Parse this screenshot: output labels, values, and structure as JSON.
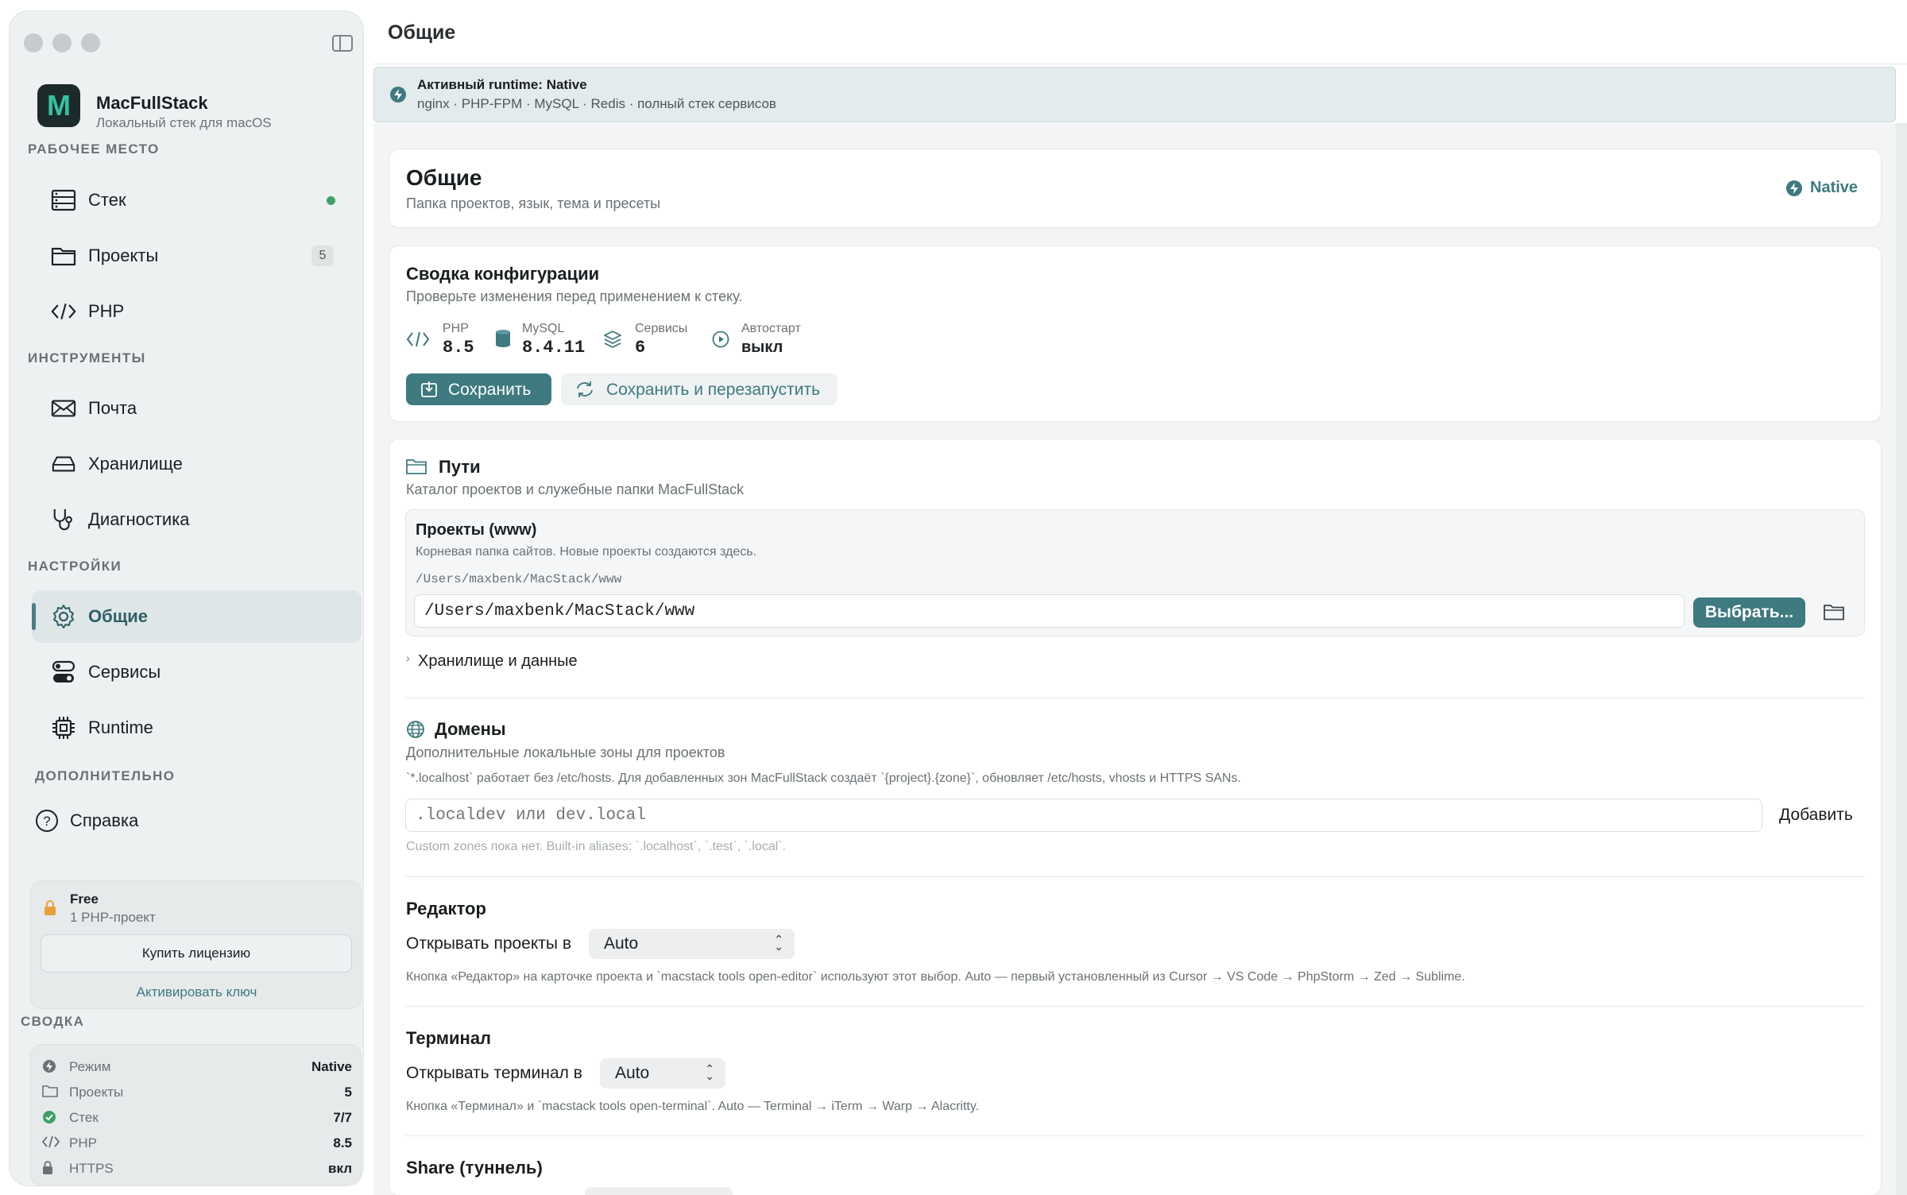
{
  "window": {
    "title": "Общие"
  },
  "brand": {
    "name": "MacFullStack",
    "subtitle": "Локальный стек для macOS",
    "logo_letter": "M"
  },
  "sidebar": {
    "sections": {
      "workspace": "РАБОЧЕЕ МЕСТО",
      "tools": "ИНСТРУМЕНТЫ",
      "settings": "НАСТРОЙКИ",
      "extra": "ДОПОЛНИТЕЛЬНО"
    },
    "items": [
      {
        "label": "Стек",
        "icon": "server-icon",
        "status": "running"
      },
      {
        "label": "Проекты",
        "icon": "folder-icon",
        "count": "5"
      },
      {
        "label": "PHP",
        "icon": "code-icon"
      },
      {
        "label": "Почта",
        "icon": "mail-icon"
      },
      {
        "label": "Хранилище",
        "icon": "drive-icon"
      },
      {
        "label": "Диагностика",
        "icon": "stethoscope-icon"
      },
      {
        "label": "Общие",
        "icon": "gear-icon",
        "active": true
      },
      {
        "label": "Сервисы",
        "icon": "toggles-icon"
      },
      {
        "label": "Runtime",
        "icon": "chip-icon"
      },
      {
        "label": "Справка",
        "icon": "help-icon"
      }
    ]
  },
  "license": {
    "plan": "Free",
    "limit": "1 PHP-проект",
    "buy_label": "Купить лицензию",
    "activate_label": "Активировать ключ"
  },
  "summary": {
    "title": "СВОДКА",
    "rows": [
      {
        "label": "Режим",
        "value": "Native",
        "icon": "bolt-icon"
      },
      {
        "label": "Проекты",
        "value": "5",
        "icon": "folder-icon"
      },
      {
        "label": "Стек",
        "value": "7/7",
        "icon": "check-circle-icon"
      },
      {
        "label": "PHP",
        "value": "8.5",
        "icon": "code-icon"
      },
      {
        "label": "HTTPS",
        "value": "вкл",
        "icon": "lock-icon"
      }
    ]
  },
  "banner": {
    "title": "Активный runtime: Native",
    "subtitle": "nginx · PHP-FPM · MySQL · Redis · полный стек сервисов"
  },
  "header_card": {
    "title": "Общие",
    "subtitle": "Папка проектов, язык, тема и пресеты",
    "badge": "Native"
  },
  "config": {
    "title": "Сводка конфигурации",
    "subtitle": "Проверьте изменения перед применением к стеку.",
    "stats": [
      {
        "label": "PHP",
        "value": "8.5"
      },
      {
        "label": "MySQL",
        "value": "8.4.11"
      },
      {
        "label": "Сервисы",
        "value": "6"
      },
      {
        "label": "Автостарт",
        "value": "выкл"
      }
    ],
    "save_label": "Сохранить",
    "save_restart_label": "Сохранить и перезапустить"
  },
  "paths": {
    "title": "Пути",
    "subtitle": "Каталог проектов и служебные папки MacFullStack",
    "projects_title": "Проекты (www)",
    "projects_desc": "Корневая папка сайтов. Новые проекты создаются здесь.",
    "current_path": "/Users/maxbenk/MacStack/www",
    "path_value": "/Users/maxbenk/MacStack/www",
    "choose_label": "Выбрать...",
    "storage_label": "Хранилище и данные"
  },
  "domains": {
    "title": "Домены",
    "subtitle": "Дополнительные локальные зоны для проектов",
    "note": "`*.localhost` работает без /etc/hosts. Для добавленных зон MacFullStack создаёт `{project}.{zone}`, обновляет /etc/hosts, vhosts и HTTPS SANs.",
    "placeholder": ".localdev или dev.local",
    "add_label": "Добавить",
    "hint": "Custom zones пока нет. Built-in aliases: `.localhost`, `.test`, `.local`."
  },
  "editor": {
    "title": "Редактор",
    "label": "Открывать проекты в",
    "value": "Auto",
    "hint": "Кнопка «Редактор» на карточке проекта и `macstack tools open-editor` используют этот выбор. Auto — первый установленный из Cursor → VS Code → PhpStorm → Zed → Sublime."
  },
  "terminal": {
    "title": "Терминал",
    "label": "Открывать терминал в",
    "value": "Auto",
    "hint": "Кнопка «Терминал» и `macstack tools open-terminal`. Auto — Terminal → iTerm → Warp → Alacritty."
  },
  "share": {
    "title": "Share (туннель)"
  },
  "colors": {
    "accent": "#3e7a80",
    "status_green": "#3f9f69",
    "sidebar_bg": "#eef1f2"
  }
}
